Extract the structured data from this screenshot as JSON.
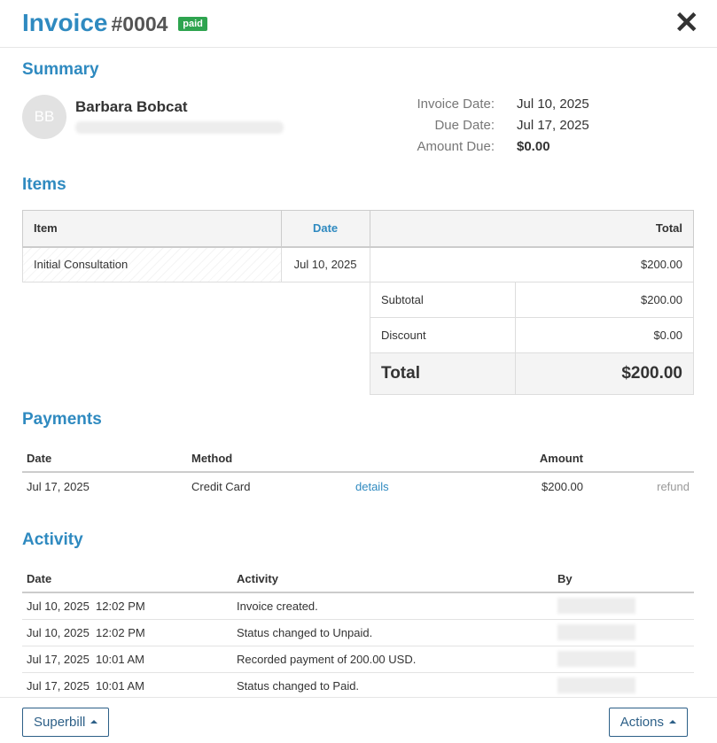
{
  "header": {
    "title": "Invoice",
    "number": "#0004",
    "status_badge": "paid",
    "close_glyph": "✕"
  },
  "summary": {
    "heading": "Summary",
    "avatar_initials": "BB",
    "client_name": "Barbara Bobcat",
    "invoice_date_label": "Invoice Date:",
    "invoice_date": "Jul 10, 2025",
    "due_date_label": "Due Date:",
    "due_date": "Jul 17, 2025",
    "amount_due_label": "Amount Due:",
    "amount_due": "$0.00"
  },
  "items": {
    "heading": "Items",
    "columns": [
      "Item",
      "Date",
      "Total"
    ],
    "rows": [
      {
        "item": "Initial Consultation",
        "date": "Jul 10, 2025",
        "total": "$200.00"
      }
    ],
    "subtotal_label": "Subtotal",
    "subtotal": "$200.00",
    "discount_label": "Discount",
    "discount": "$0.00",
    "total_label": "Total",
    "total": "$200.00"
  },
  "payments": {
    "heading": "Payments",
    "columns": [
      "Date",
      "Method",
      "",
      "Amount",
      ""
    ],
    "rows": [
      {
        "date": "Jul 17, 2025",
        "method": "Credit Card",
        "details_link": "details",
        "amount": "$200.00",
        "refund_link": "refund"
      }
    ]
  },
  "activity": {
    "heading": "Activity",
    "columns": [
      "Date",
      "Activity",
      "By"
    ],
    "rows": [
      {
        "date": "Jul 10, 2025  12:02 PM",
        "activity": "Invoice created."
      },
      {
        "date": "Jul 10, 2025  12:02 PM",
        "activity": "Status changed to Unpaid."
      },
      {
        "date": "Jul 17, 2025  10:01 AM",
        "activity": "Recorded payment of 200.00 USD."
      },
      {
        "date": "Jul 17, 2025  10:01 AM",
        "activity": "Status changed to Paid."
      }
    ]
  },
  "footer": {
    "superbill_label": "Superbill",
    "actions_label": "Actions"
  },
  "colors": {
    "accent": "#2f8ac0",
    "paid_badge": "#2ea44f",
    "button_border": "#2c5f87"
  }
}
